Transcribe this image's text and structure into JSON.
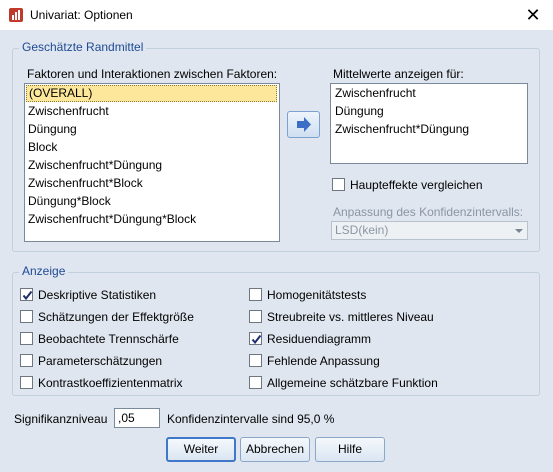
{
  "window": {
    "title": "Univariat: Optionen",
    "close_glyph": "✕"
  },
  "estimated_means": {
    "group_label": "Geschätzte Randmittel",
    "factors_label": "Faktoren und Interaktionen zwischen Faktoren:",
    "factors": [
      "(OVERALL)",
      "Zwischenfrucht",
      "Düngung",
      "Block",
      "Zwischenfrucht*Düngung",
      "Zwischenfrucht*Block",
      "Düngung*Block",
      "Zwischenfrucht*Düngung*Block"
    ],
    "selected_factor": "(OVERALL)",
    "display_means_label": "Mittelwerte anzeigen für:",
    "display_means": [
      "Zwischenfrucht",
      "Düngung",
      "Zwischenfrucht*Düngung"
    ],
    "compare_main_effects_label": "Haupteffekte vergleichen",
    "compare_main_effects_checked": false,
    "ci_adjustment_label": "Anpassung des Konfidenzintervalls:",
    "ci_adjustment_value": "LSD(kein)"
  },
  "display": {
    "group_label": "Anzeige",
    "left_options": [
      {
        "label": "Deskriptive Statistiken",
        "checked": true
      },
      {
        "label": "Schätzungen der Effektgröße",
        "checked": false
      },
      {
        "label": "Beobachtete Trennschärfe",
        "checked": false
      },
      {
        "label": "Parameterschätzungen",
        "checked": false
      },
      {
        "label": "Kontrastkoeffizientenmatrix",
        "checked": false
      }
    ],
    "right_options": [
      {
        "label": "Homogenitätstests",
        "checked": false
      },
      {
        "label": "Streubreite vs. mittleres Niveau",
        "checked": false
      },
      {
        "label": "Residuendiagramm",
        "checked": true
      },
      {
        "label": "Fehlende Anpassung",
        "checked": false
      },
      {
        "label": "Allgemeine schätzbare Funktion",
        "checked": false
      }
    ]
  },
  "significance": {
    "label": "Signifikanzniveau",
    "value": ",05",
    "ci_text": "Konfidenzintervalle sind 95,0 %"
  },
  "buttons": {
    "continue": "Weiter",
    "cancel": "Abbrechen",
    "help": "Hilfe"
  },
  "colors": {
    "dialog_bg": "#dfe6ef",
    "group_label": "#1f4a94",
    "selection": "#fce79a",
    "arrow_button": "#3b6fc4"
  }
}
